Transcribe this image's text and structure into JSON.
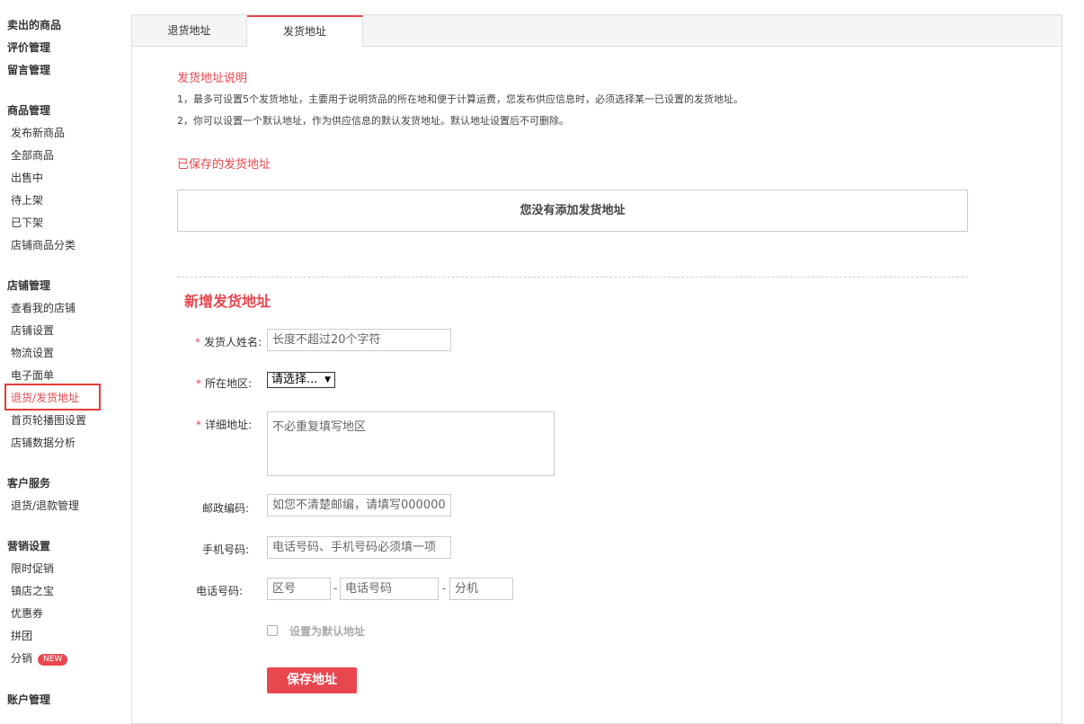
{
  "sidebar": {
    "groups": [
      {
        "title": "卖出的商品"
      },
      {
        "title": "评价管理"
      },
      {
        "title": "留言管理"
      },
      {
        "title": "商品管理",
        "items": [
          "发布新商品",
          "全部商品",
          "出售中",
          "待上架",
          "已下架",
          "店铺商品分类"
        ]
      },
      {
        "title": "店铺管理",
        "items": [
          "查看我的店铺",
          "店铺设置",
          "物流设置",
          "电子面单",
          "退货/发货地址",
          "首页轮播图设置",
          "店铺数据分析"
        ]
      },
      {
        "title": "客户服务",
        "items": [
          "退货/退款管理"
        ]
      },
      {
        "title": "营销设置",
        "items": [
          "限时促销",
          "镇店之宝",
          "优惠券",
          "拼团",
          "分销"
        ]
      },
      {
        "title": "账户管理"
      }
    ],
    "new_badge": "NEW",
    "active_item": "退货/发货地址"
  },
  "tabs": [
    {
      "label": "退货地址",
      "active": false
    },
    {
      "label": "发货地址",
      "active": true
    }
  ],
  "info": {
    "title": "发货地址说明",
    "line1": "1，最多可设置5个发货地址，主要用于说明货品的所在地和便于计算运费，您发布供应信息时，必须选择某一已设置的发货地址。",
    "line2": "2，你可以设置一个默认地址，作为供应信息的默认发货地址。默认地址设置后不可删除。"
  },
  "saved": {
    "title": "已保存的发货地址",
    "empty_text": "您没有添加发货地址"
  },
  "form": {
    "title": "新增发货地址",
    "required_mark": "*",
    "name_label": "发货人姓名:",
    "name_placeholder": "长度不超过20个字符",
    "region_label": "所在地区:",
    "region_value": "请选择...",
    "address_label": "详细地址:",
    "address_placeholder": "不必重复填写地区",
    "zip_label": "邮政编码:",
    "zip_placeholder": "如您不清楚邮编，请填写000000",
    "mobile_label": "手机号码:",
    "mobile_placeholder": "电话号码、手机号码必须填一项",
    "phone_label": "电话号码:",
    "area_code_placeholder": "区号",
    "phone_placeholder": "电话号码",
    "ext_placeholder": "分机",
    "separator": "-",
    "default_label": "设置为默认地址",
    "save_label": "保存地址"
  },
  "colors": {
    "accent": "#e8474f",
    "highlight_box": "#e23b3b"
  }
}
